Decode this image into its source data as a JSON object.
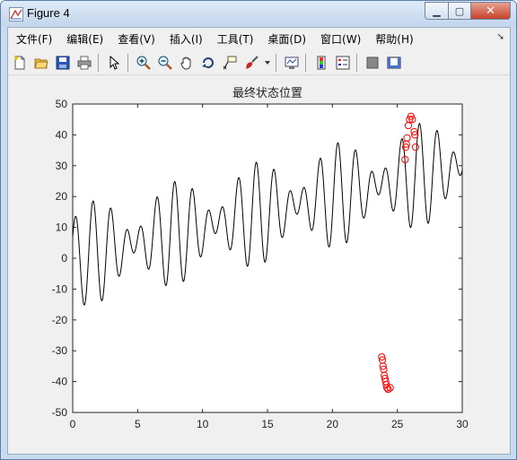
{
  "window": {
    "title": "Figure 4"
  },
  "menu": [
    "文件(F)",
    "编辑(E)",
    "查看(V)",
    "插入(I)",
    "工具(T)",
    "桌面(D)",
    "窗口(W)",
    "帮助(H)"
  ],
  "toolbar_icons": [
    "new-figure-icon",
    "open-icon",
    "save-icon",
    "print-icon",
    "pointer-icon",
    "zoom-in-icon",
    "zoom-out-icon",
    "pan-icon",
    "rotate-icon",
    "data-cursor-icon",
    "brush-icon",
    "link-icon",
    "colorbar-icon",
    "legend-icon",
    "hide-plot-tools-icon",
    "show-plot-tools-icon"
  ],
  "chart_data": {
    "type": "line",
    "title": "最终状态位置",
    "xlabel": "",
    "ylabel": "",
    "xlim": [
      0,
      30
    ],
    "ylim": [
      -50,
      50
    ],
    "xticks": [
      0,
      5,
      10,
      15,
      20,
      25,
      30
    ],
    "yticks": [
      50,
      40,
      30,
      20,
      10,
      0,
      -10,
      -20,
      -30,
      -40,
      -50
    ],
    "line": {
      "color": "#000000",
      "function": "x + 10*sin(5*x) + 7*cos(4*x)",
      "x_range": [
        0,
        30
      ]
    },
    "markers": {
      "color": "#ff0000",
      "symbol": "circle",
      "points": [
        {
          "x": 23.8,
          "y": -32
        },
        {
          "x": 23.85,
          "y": -33
        },
        {
          "x": 23.9,
          "y": -35
        },
        {
          "x": 23.95,
          "y": -36
        },
        {
          "x": 24.0,
          "y": -38
        },
        {
          "x": 24.05,
          "y": -39
        },
        {
          "x": 24.1,
          "y": -40
        },
        {
          "x": 24.15,
          "y": -41
        },
        {
          "x": 24.2,
          "y": -42
        },
        {
          "x": 24.3,
          "y": -42.5
        },
        {
          "x": 24.45,
          "y": -42
        },
        {
          "x": 25.6,
          "y": 32
        },
        {
          "x": 25.65,
          "y": 36
        },
        {
          "x": 25.7,
          "y": 37
        },
        {
          "x": 25.75,
          "y": 39
        },
        {
          "x": 25.85,
          "y": 43
        },
        {
          "x": 25.95,
          "y": 45
        },
        {
          "x": 26.05,
          "y": 46
        },
        {
          "x": 26.15,
          "y": 45
        },
        {
          "x": 26.3,
          "y": 41
        },
        {
          "x": 26.35,
          "y": 40
        },
        {
          "x": 26.4,
          "y": 36
        }
      ]
    }
  }
}
